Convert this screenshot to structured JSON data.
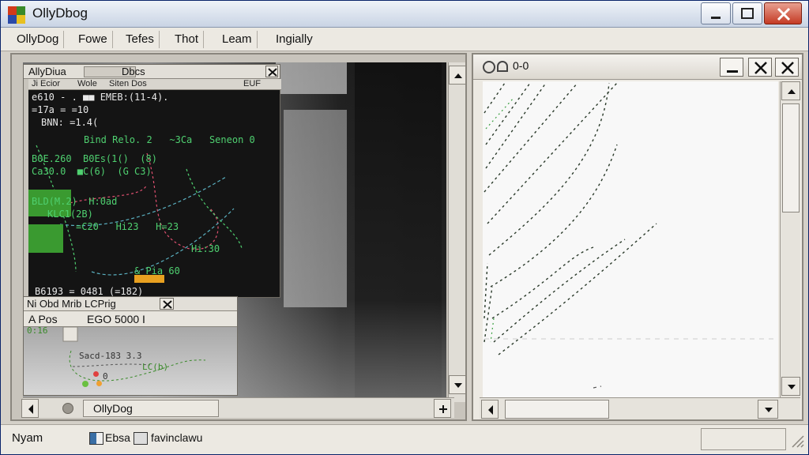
{
  "window": {
    "title": "OllyDbog",
    "controls": {
      "minimize": "minimize",
      "maximize": "maximize",
      "close": "close"
    }
  },
  "menu": {
    "items": [
      "OllyDog",
      "Fowe",
      "Tefes",
      "Thot",
      "Leam",
      "Ingially"
    ]
  },
  "left_pane": {
    "inner_window_1": {
      "title": "AllyDiua",
      "tab": "Dbcs",
      "tools": [
        "Ji Ecior",
        "Wole",
        "Siten Dos",
        "EUF"
      ],
      "code_lines": [
        {
          "text": "e610 - . ■■ EMEB:(11-4).",
          "color": "w"
        },
        {
          "text": "=17a = =10",
          "color": "w"
        },
        {
          "text": "BNN: =1.4(",
          "color": "w"
        },
        {
          "text": "Bind Relo. 2   ~3Ca   Seneon 0",
          "color": "g"
        },
        {
          "text": "B0E.260  B0Es(1()  (8)",
          "color": "g"
        },
        {
          "text": "Ca30.0  ■C(6)  (G C3)",
          "color": "g"
        },
        {
          "text": "BLD(M.2)  H:0ad",
          "color": "g"
        },
        {
          "text": "KLC1(2B)",
          "color": "g"
        },
        {
          "text": "=C20   Hi23   H=23",
          "color": "g"
        },
        {
          "text": "Hi:30",
          "color": "g"
        },
        {
          "text": "& Pia 60",
          "color": "g"
        },
        {
          "text": "B6193 = 0481 (=182)",
          "color": "w"
        }
      ]
    },
    "inner_window_2": {
      "title": "Ni Obd Mrib LCPrig",
      "tools": [
        "A Pos",
        "EGO  5000 I"
      ],
      "labels": [
        "0:16",
        "Sacd-183 3.3",
        "LC(b)",
        "0"
      ]
    },
    "bottom_label": "OllyDog"
  },
  "right_pane": {
    "title": "0-0",
    "controls": {
      "minimize": "minimize",
      "maximize": "maximize",
      "close": "close"
    }
  },
  "status": {
    "left": "Nyam",
    "mid1": "Ebsa",
    "mid2": "favinclawu"
  },
  "colors": {
    "titlebar": "#c9d4e4",
    "code_bg": "#141414",
    "code_green": "#4fd070",
    "accent": "#3a6ea5"
  }
}
